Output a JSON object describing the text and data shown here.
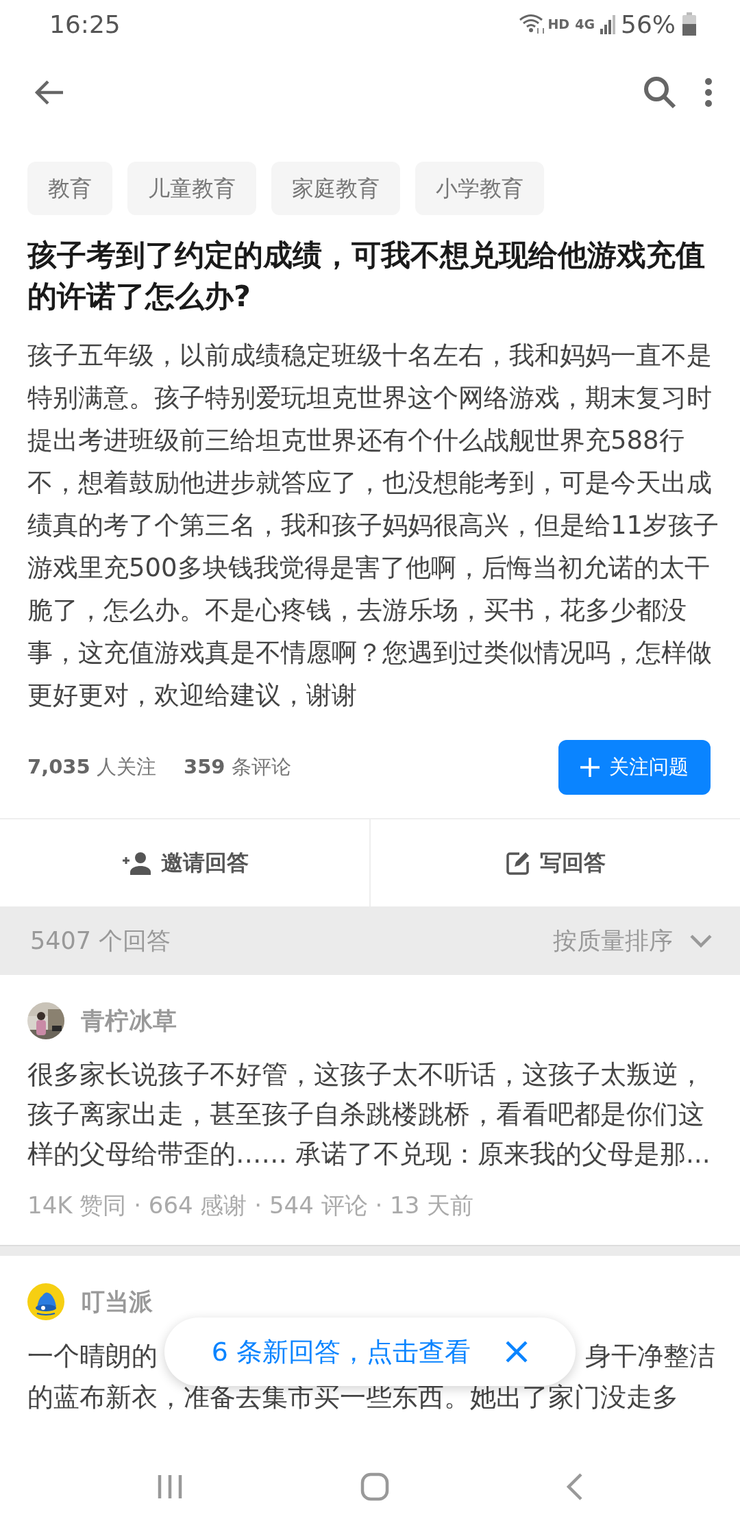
{
  "status_bar": {
    "time": "16:25",
    "network": "HD",
    "cellular": "4G",
    "battery": "56%"
  },
  "tags": [
    "教育",
    "儿童教育",
    "家庭教育",
    "小学教育"
  ],
  "question": {
    "title": "孩子考到了约定的成绩，可我不想兑现给他游戏充值的许诺了怎么办?",
    "body": "孩子五年级，以前成绩稳定班级十名左右，我和妈妈一直不是特别满意。孩子特别爱玩坦克世界这个网络游戏，期末复习时提出考进班级前三给坦克世界还有个什么战舰世界充588行不，想着鼓励他进步就答应了，也没想能考到，可是今天出成绩真的考了个第三名，我和孩子妈妈很高兴，但是给11岁孩子游戏里充500多块钱我觉得是害了他啊，后悔当初允诺的太干脆了，怎么办。不是心疼钱，去游乐场，买书，花多少都没事，这充值游戏真是不情愿啊？您遇到过类似情况吗，怎样做更好更对，欢迎给建议，谢谢",
    "followers_count": "7,035",
    "followers_label": "人关注",
    "comments_count": "359",
    "comments_label": "条评论",
    "follow_button": "关注问题"
  },
  "actions": [
    {
      "kind": "invite",
      "label": "邀请回答"
    },
    {
      "kind": "write",
      "label": "写回答"
    }
  ],
  "answers_header": {
    "count": "5407 个回答",
    "sort": "按质量排序"
  },
  "answers": [
    {
      "author": "青柠冰草",
      "kind": "photo-avatar",
      "excerpt": "很多家长说孩子不好管，这孩子太不听话，这孩子太叛逆，孩子离家出走，甚至孩子自杀跳楼跳桥，看看吧都是你们这样的父母给带歪的…… 承诺了不兑现：原来我的父母是那...",
      "meta": "14K 赞同 · 664 感谢 · 544 评论 · 13 天前"
    },
    {
      "author": "叮当派",
      "kind": "logo-avatar",
      "excerpt_parts": [
        "一个晴朗的",
        "身干净整洁",
        "的蓝布新衣，准备去集市买一些东西。她出了家门没走多"
      ]
    }
  ],
  "toast": {
    "text": "6 条新回答，点击查看"
  }
}
